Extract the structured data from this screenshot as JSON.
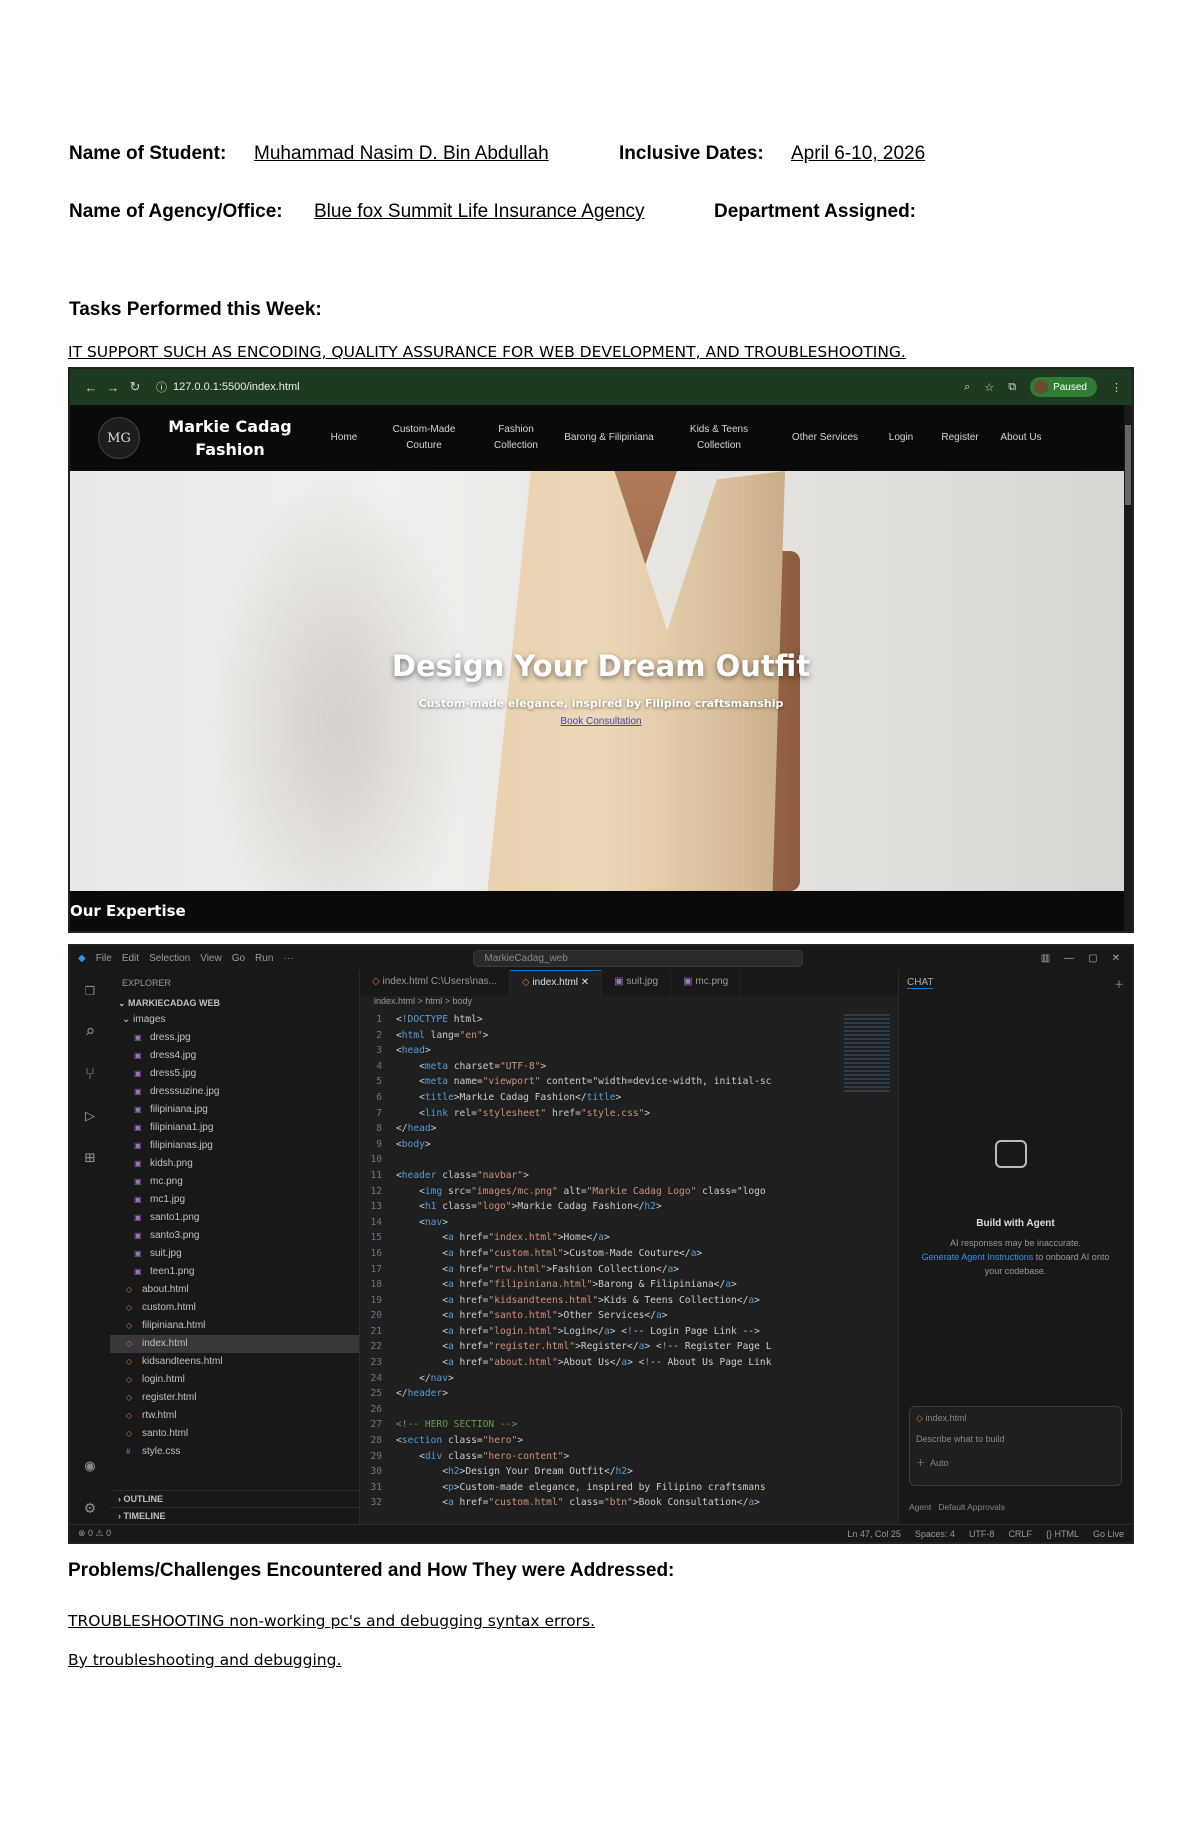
{
  "header": {
    "student_label": "Name of Student:",
    "student_value": "Muhammad Nasim D. Bin Abdullah",
    "dates_label": "Inclusive Dates:",
    "dates_value": "April 6-10, 2026",
    "agency_label": "Name of Agency/Office:",
    "agency_value": "Blue fox Summit Life Insurance Agency",
    "dept_label": "Department Assigned:"
  },
  "tasks": {
    "heading": "Tasks Performed this Week:",
    "text": "IT SUPPORT SUCH AS ENCODING, QUALITY ASSURANCE FOR WEB DEVELOPMENT, AND TROUBLESHOOTING."
  },
  "browser": {
    "url": "127.0.0.1:5500/index.html",
    "paused_label": "Paused",
    "logo_mark": "MG",
    "site_title": "Markie Cadag Fashion",
    "nav": [
      "Home",
      "Custom-Made Couture",
      "Fashion Collection",
      "Barong & Filipiniana",
      "Kids & Teens Collection",
      "Other Services",
      "Login",
      "Register",
      "About Us"
    ],
    "hero_title": "Design Your Dream Outfit",
    "hero_subtitle": "Custom-made elegance, inspired by Filipino craftsmanship",
    "hero_button": "Book Consultation",
    "section_title": "Our Expertise"
  },
  "vscode": {
    "menu": [
      "File",
      "Edit",
      "Selection",
      "View",
      "Go",
      "Run",
      "···"
    ],
    "search_text": "MarkieCadag_web",
    "explorer_title": "EXPLORER",
    "project_name": "MARKIECADAG WEB",
    "images_folder": "images",
    "image_files": [
      "dress.jpg",
      "dress4.jpg",
      "dress5.jpg",
      "dresssuzine.jpg",
      "filipiniana.jpg",
      "filipiniana1.jpg",
      "filipinianas.jpg",
      "kidsh.png",
      "mc.png",
      "mc1.jpg",
      "santo1.png",
      "santo3.png",
      "suit.jpg",
      "teen1.png"
    ],
    "html_files": [
      "about.html",
      "custom.html",
      "filipiniana.html",
      "index.html",
      "kidsandteens.html",
      "login.html",
      "register.html",
      "rtw.html",
      "santo.html"
    ],
    "css_file": "style.css",
    "selected_file": "index.html",
    "outline_label": "OUTLINE",
    "timeline_label": "TIMELINE",
    "tabs": [
      "index.html C:\\Users\\nas...",
      "index.html",
      "suit.jpg",
      "mc.png"
    ],
    "breadcrumb": "index.html > html > body",
    "code_lines": [
      "<!DOCTYPE html>",
      "<html lang=\"en\">",
      "<head>",
      "    <meta charset=\"UTF-8\">",
      "    <meta name=\"viewport\" content=\"width=device-width, initial-sc",
      "    <title>Markie Cadag Fashion</title>",
      "    <link rel=\"stylesheet\" href=\"style.css\">",
      "</head>",
      "<body>",
      "",
      "<header class=\"navbar\">",
      "    <img src=\"images/mc.png\" alt=\"Markie Cadag Logo\" class=\"logo",
      "    <h1 class=\"logo\">Markie Cadag Fashion</h2>",
      "    <nav>",
      "        <a href=\"index.html\">Home</a>",
      "        <a href=\"custom.html\">Custom-Made Couture</a>",
      "        <a href=\"rtw.html\">Fashion Collection</a>",
      "        <a href=\"filipiniana.html\">Barong & Filipiniana</a>",
      "        <a href=\"kidsandteens.html\">Kids & Teens Collection</a>",
      "        <a href=\"santo.html\">Other Services</a>",
      "        <a href=\"login.html\">Login</a> <!-- Login Page Link -->",
      "        <a href=\"register.html\">Register</a> <!-- Register Page L",
      "        <a href=\"about.html\">About Us</a> <!-- About Us Page Link",
      "    </nav>",
      "</header>",
      "",
      "<!-- HERO SECTION -->",
      "<section class=\"hero\">",
      "    <div class=\"hero-content\">",
      "        <h2>Design Your Dream Outfit</h2>",
      "        <p>Custom-made elegance, inspired by Filipino craftsmans",
      "        <a href=\"custom.html\" class=\"btn\">Book Consultation</a>"
    ],
    "chat_tab": "CHAT",
    "chat_title": "Build with Agent",
    "chat_sub_1": "AI responses may be inaccurate.",
    "chat_sub_link": "Generate Agent Instructions",
    "chat_sub_2": "to onboard AI onto your codebase.",
    "chat_context": "index.html",
    "chat_placeholder": "Describe what to build",
    "chat_mode": "Auto",
    "chat_agent": "Agent",
    "chat_approvals": "Default Approvals",
    "status_left": "⊗ 0 ⚠ 0",
    "status_right": [
      "Ln 47, Col 25",
      "Spaces: 4",
      "UTF-8",
      "CRLF",
      "{} HTML",
      "Go Live"
    ]
  },
  "problems": {
    "heading": "Problems/Challenges Encountered and How They were Addressed:",
    "line1": "TROUBLESHOOTING non-working pc's and debugging syntax errors.",
    "line2": "By troubleshooting and debugging."
  }
}
